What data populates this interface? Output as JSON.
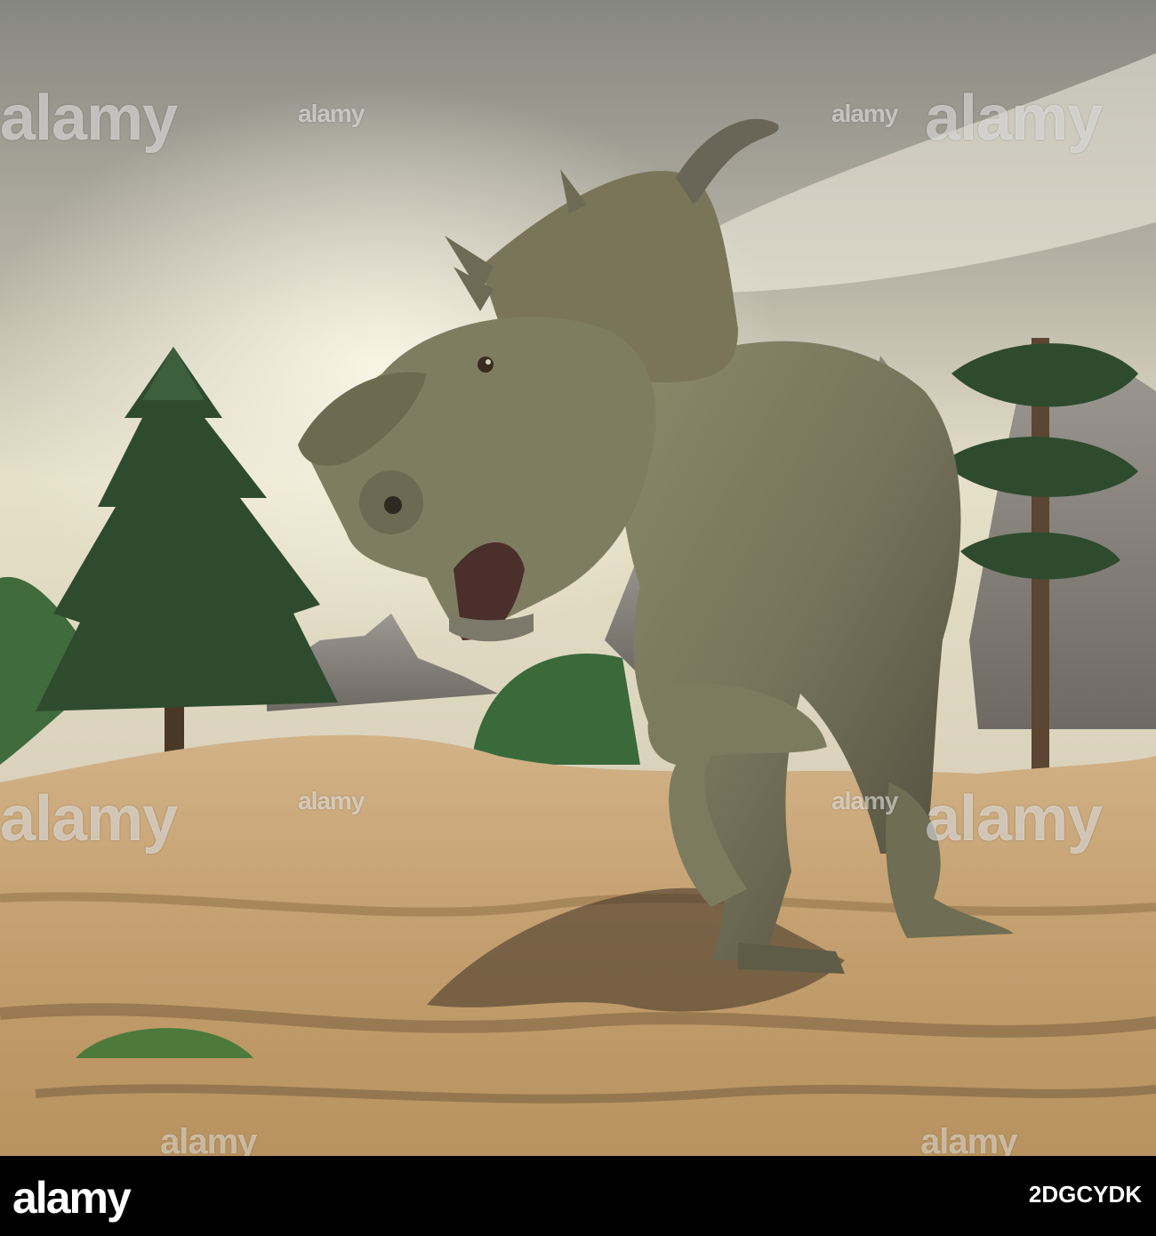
{
  "watermark": {
    "text": "alamy",
    "color": "#ffffff"
  },
  "footer": {
    "logo": "alamy",
    "image_id": "2DGCYDK",
    "background": "#000000"
  },
  "scene": {
    "subject": "pachyrhinosaurus-dinosaur",
    "palette": {
      "sky_top": "#8e8e87",
      "sky_glow": "#f3efd9",
      "ground": "#c9a77a",
      "ground_dark": "#5a4731",
      "dino_skin": "#77755b",
      "dino_shadow": "#3c3a2c",
      "tree": "#2e4a2d",
      "mountain": "#8f8a82"
    }
  }
}
